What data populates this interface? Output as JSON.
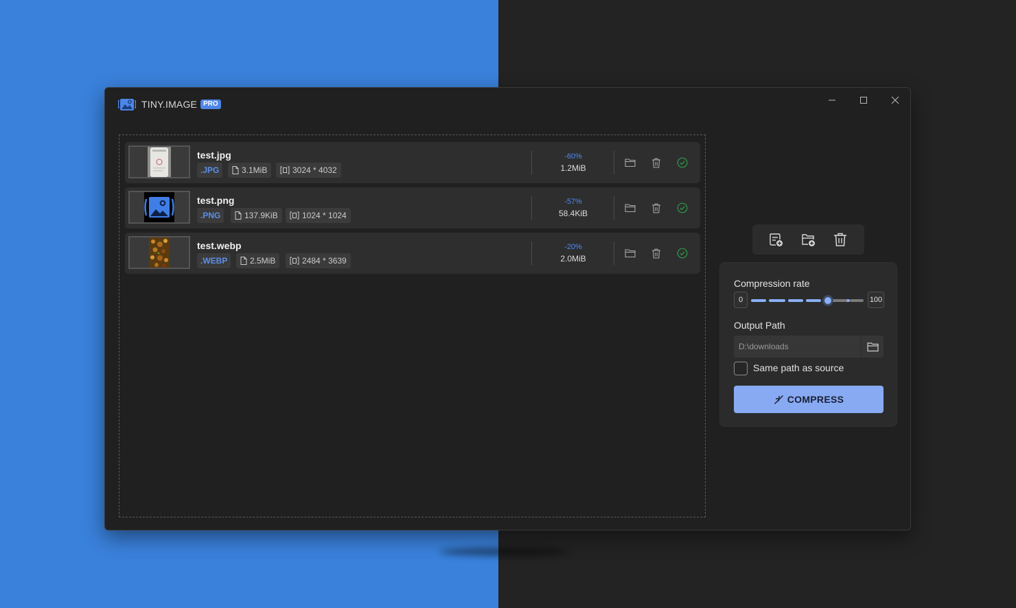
{
  "app": {
    "title": "TINY.IMAGE",
    "badge": "PRO"
  },
  "window_controls": [
    "minimize-icon",
    "maximize-icon",
    "close-icon"
  ],
  "files": [
    {
      "name": "test.jpg",
      "ext": ".JPG",
      "size": "3.1MiB",
      "dimensions": "3024 * 4032",
      "rate": "-60%",
      "new_size": "1.2MiB",
      "status": "done",
      "thumb": "bottle"
    },
    {
      "name": "test.png",
      "ext": ".PNG",
      "size": "137.9KiB",
      "dimensions": "1024 * 1024",
      "rate": "-57%",
      "new_size": "58.4KiB",
      "status": "done",
      "thumb": "logo"
    },
    {
      "name": "test.webp",
      "ext": ".WEBP",
      "size": "2.5MiB",
      "dimensions": "2484 * 3639",
      "rate": "-20%",
      "new_size": "2.0MiB",
      "status": "done",
      "thumb": "food"
    }
  ],
  "row_actions": [
    "open-folder-icon",
    "delete-icon",
    "check-circle-icon"
  ],
  "toolbar": [
    "add-file-icon",
    "add-folder-icon",
    "clear-all-icon"
  ],
  "settings": {
    "compression_label": "Compression rate",
    "min": "0",
    "max": "100",
    "value": 70,
    "output_label": "Output Path",
    "output_path": "D:\\downloads",
    "same_path_label": "Same path as source",
    "same_path_checked": false,
    "compress_label": "COMPRESS"
  },
  "colors": {
    "accent": "#88aaf3",
    "accent_text": "#4e8bf0",
    "badge": "#4e86e6",
    "success": "#2e9a4a",
    "left_bg": "#3a81db"
  }
}
